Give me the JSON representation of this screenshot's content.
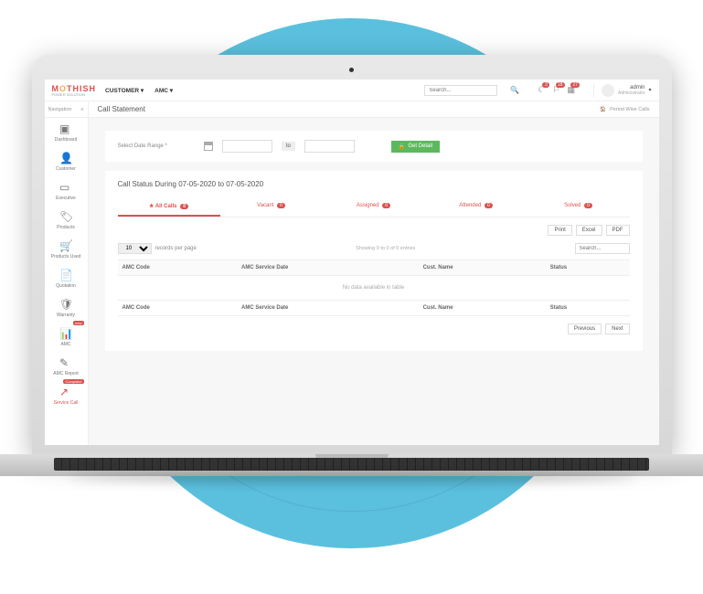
{
  "header": {
    "logo_main": "MOTHISH",
    "logo_sub": "POWER SOLUTION",
    "menu": [
      "CUSTOMER ▾",
      "AMC ▾"
    ],
    "search_placeholder": "Search...",
    "notifications": [
      {
        "icon": "bell",
        "count": "3"
      },
      {
        "icon": "flag",
        "count": "18"
      },
      {
        "icon": "grid",
        "count": "27"
      }
    ],
    "user_name": "admin",
    "user_role": "Administrator"
  },
  "sidebar": {
    "label": "Navigation",
    "items": [
      {
        "label": "Dashboard",
        "icon": "dashboard"
      },
      {
        "label": "Customer",
        "icon": "user"
      },
      {
        "label": "Executive",
        "icon": "briefcase"
      },
      {
        "label": "Products",
        "icon": "tag"
      },
      {
        "label": "Products Used",
        "icon": "cart"
      },
      {
        "label": "Quotation",
        "icon": "file"
      },
      {
        "label": "Warranty",
        "icon": "shield"
      },
      {
        "label": "AMC",
        "icon": "chart",
        "tag": "new"
      },
      {
        "label": "AMC Report",
        "icon": "edit"
      },
      {
        "label": "Service Call",
        "icon": "call",
        "tag": "Complaint",
        "active": true
      }
    ]
  },
  "page": {
    "title": "Call Statement",
    "breadcrumb": "Period Wise Calls"
  },
  "filter": {
    "label": "Select Date Range *",
    "to_label": "to",
    "button": "Get Detail"
  },
  "panel": {
    "title": "Call Status During 07-05-2020 to 07-05-2020",
    "tabs": [
      {
        "label": "All Calls",
        "count": "0",
        "star": true,
        "active": true
      },
      {
        "label": "Vacant",
        "count": "0"
      },
      {
        "label": "Assigned",
        "count": "0"
      },
      {
        "label": "Attended",
        "count": "0"
      },
      {
        "label": "Solved",
        "count": "0"
      }
    ],
    "export": [
      "Print",
      "Excel",
      "PDF"
    ],
    "per_page": "10",
    "per_page_label": "records per page",
    "showing": "Showing 0 to 0 of 0 entries",
    "search_placeholder": "Search...",
    "columns": [
      "AMC Code",
      "AMC Service Date",
      "Cust. Name",
      "Status"
    ],
    "empty": "No data available in table",
    "pager": [
      "Previous",
      "Next"
    ]
  }
}
